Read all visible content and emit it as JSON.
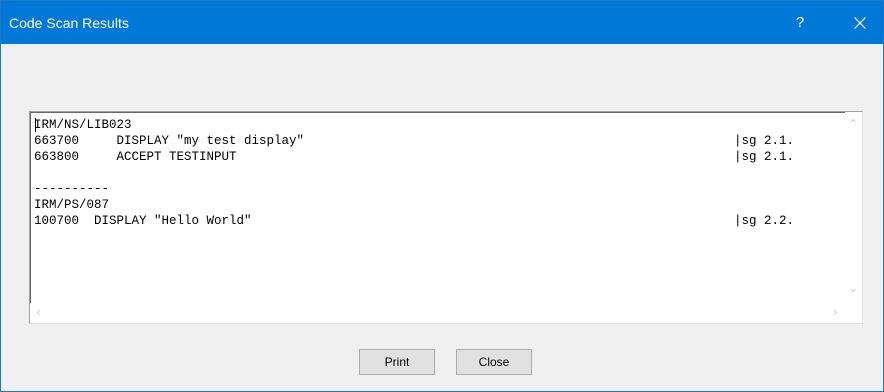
{
  "window": {
    "title": "Code Scan Results",
    "help_glyph": "?"
  },
  "results": {
    "lines": [
      {
        "text": "IRM/NS/LIB023",
        "ref": ""
      },
      {
        "text": "663700     DISPLAY \"my test display\"",
        "ref": "|sg 2.1."
      },
      {
        "text": "663800     ACCEPT TESTINPUT",
        "ref": "|sg 2.1."
      },
      {
        "text": "",
        "ref": ""
      },
      {
        "text": "----------",
        "ref": ""
      },
      {
        "text": "IRM/PS/087",
        "ref": ""
      },
      {
        "text": "100700  DISPLAY \"Hello World\"",
        "ref": "|sg 2.2."
      }
    ]
  },
  "buttons": {
    "print_label": "Print",
    "close_label": "Close"
  },
  "icons": {
    "help": "question-mark-icon",
    "close": "close-x-icon",
    "scroll_up": "chevron-up-icon",
    "scroll_down": "chevron-down-icon",
    "scroll_left": "chevron-left-icon",
    "scroll_right": "chevron-right-icon"
  },
  "colors": {
    "titlebar": "#0078d7",
    "window_bg": "#f0f0f0",
    "button_bg": "#e1e1e1"
  }
}
